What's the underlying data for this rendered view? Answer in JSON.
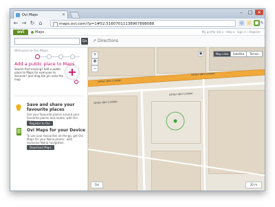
{
  "browser": {
    "tab_title": "Ovi Maps",
    "url": "maps.ovi.com/?p=1#52.51607011138967898088"
  },
  "site": {
    "logo": "ovi",
    "maps_label": "Maps",
    "top_links": "My profile link ▾ · Help ▾ · Sign in / Register"
  },
  "search": {
    "placeholder": "",
    "button": "Go",
    "directions": "Directions"
  },
  "panel": {
    "welcome": "Welcome to Ovi Maps",
    "add_title": "Add a public place to Maps",
    "add_text": "Search find missing? Add a public place to Maps for everyone to discover! Just drag the pin onto the map",
    "save_title": "Save and share your favourite places",
    "save_text": "Get your favourite places around your favourite places and routes, with Ovi Maps.",
    "save_button": "Register to Ovi",
    "mobile_title": "Ovi Maps for your Device",
    "mobile_text": "To use your favourites on-the-go, get Ovi Maps for your Nokia phone - with exclusive Nokia navigation.",
    "mobile_button": "Download Maps"
  },
  "map": {
    "types": [
      "Map view",
      "Satellite",
      "Terrain"
    ],
    "street_labels": [
      "Unter den Linden",
      "Unter den Linden",
      "Unter den Linden",
      "Unter den Linden"
    ],
    "zoom_in": "+",
    "zoom_out": "−",
    "bottom_left": "Ovi",
    "bottom_right": "20 m"
  },
  "colors": {
    "accent": "#c8116d",
    "brand": "#5f8f23",
    "road_main": "#f0a93a",
    "map_bg": "#ebe6dc",
    "marker": "#3aa53a"
  }
}
